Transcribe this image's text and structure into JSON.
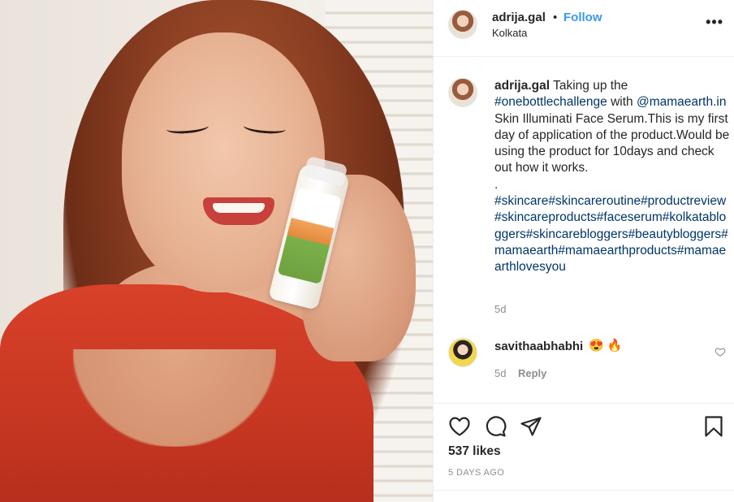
{
  "post": {
    "username": "adrija.gal",
    "separator": "•",
    "follow_label": "Follow",
    "location": "Kolkata",
    "more_label": "•••"
  },
  "caption": {
    "username": "adrija.gal",
    "text_1": "Taking up the",
    "hashtag_1": "#onebottlechallenge",
    "text_2": "with",
    "mention": "@mamaearth.in",
    "text_3": "Skin Illuminati Face Serum.This is my first day of application of the product.Would be using the product for 10days and check out how it works.",
    "dot": ".",
    "hashtags": "#skincare#skincareroutine#productreview#skincareproducts#faceserum#kolkatabloggers#skincarebloggers#beautybloggers#mamaearth#mamaearthproducts#mamaearthlovesyou",
    "time": "5d"
  },
  "comment": {
    "username": "savithaabhabhi",
    "emojis": "😍 🔥",
    "time": "5d",
    "reply_label": "Reply"
  },
  "actions": {
    "likes": "537 likes",
    "posted": "5 DAYS AGO"
  },
  "icons": {
    "like": "heart-icon",
    "comment": "comment-bubble-icon",
    "share": "paper-plane-icon",
    "save": "bookmark-icon",
    "more": "more-options-icon",
    "comment_like": "small-heart-icon"
  },
  "colors": {
    "link_blue": "#3897f0",
    "hashtag": "#003569",
    "meta_gray": "#8e8e8e",
    "text": "#262626"
  }
}
